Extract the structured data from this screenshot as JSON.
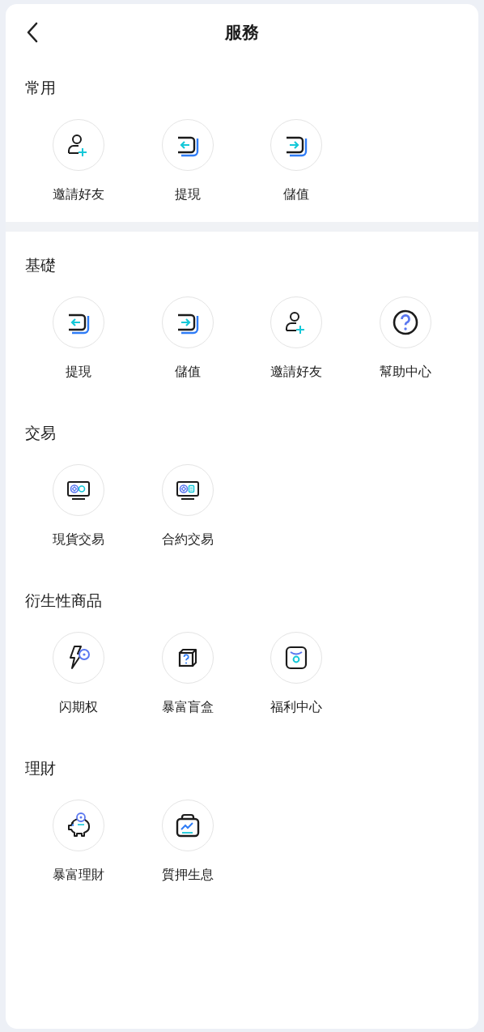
{
  "header": {
    "title": "服務"
  },
  "sections": [
    {
      "kind": "group",
      "title": "常用",
      "items": [
        {
          "label": "邀請好友",
          "kind": "invite"
        },
        {
          "label": "提現",
          "kind": "withdraw"
        },
        {
          "label": "儲值",
          "kind": "deposit"
        }
      ]
    },
    {
      "kind": "divider"
    },
    {
      "kind": "group",
      "title": "基礎",
      "items": [
        {
          "label": "提現",
          "kind": "withdraw"
        },
        {
          "label": "儲值",
          "kind": "deposit"
        },
        {
          "label": "邀請好友",
          "kind": "invite"
        },
        {
          "label": "幫助中心",
          "kind": "help"
        }
      ]
    },
    {
      "kind": "group",
      "title": "交易",
      "items": [
        {
          "label": "現貨交易",
          "kind": "spot"
        },
        {
          "label": "合約交易",
          "kind": "contract"
        }
      ]
    },
    {
      "kind": "group",
      "title": "衍生性商品",
      "items": [
        {
          "label": "闪期权",
          "kind": "flash"
        },
        {
          "label": "暴富盲盒",
          "kind": "blindbox"
        },
        {
          "label": "福利中心",
          "kind": "welfare"
        }
      ]
    },
    {
      "kind": "group",
      "title": "理財",
      "items": [
        {
          "label": "暴富理財",
          "kind": "piggy"
        },
        {
          "label": "質押生息",
          "kind": "pledge"
        }
      ]
    }
  ]
}
